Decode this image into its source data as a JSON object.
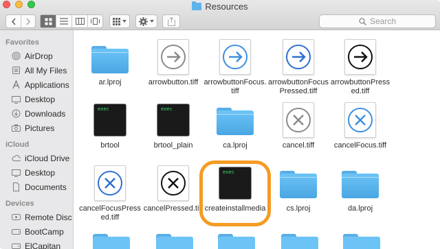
{
  "window": {
    "title": "Resources"
  },
  "toolbar": {
    "back_icon": "chevron-left-icon",
    "forward_icon": "chevron-right-icon",
    "view_modes": [
      "icon-view-icon",
      "list-view-icon",
      "column-view-icon",
      "coverflow-view-icon"
    ],
    "arrange_icon": "arrange-grid-icon",
    "action_icon": "gear-icon",
    "share_icon": "share-icon",
    "search_placeholder": "Search"
  },
  "sidebar": {
    "sections": [
      {
        "title": "Favorites",
        "items": [
          {
            "label": "AirDrop",
            "icon": "airdrop-icon"
          },
          {
            "label": "All My Files",
            "icon": "all-files-icon"
          },
          {
            "label": "Applications",
            "icon": "applications-icon"
          },
          {
            "label": "Desktop",
            "icon": "desktop-icon"
          },
          {
            "label": "Downloads",
            "icon": "downloads-icon"
          },
          {
            "label": "Pictures",
            "icon": "pictures-icon"
          }
        ]
      },
      {
        "title": "iCloud",
        "items": [
          {
            "label": "iCloud Drive",
            "icon": "cloud-icon"
          },
          {
            "label": "Desktop",
            "icon": "desktop-icon"
          },
          {
            "label": "Documents",
            "icon": "documents-icon"
          }
        ]
      },
      {
        "title": "Devices",
        "items": [
          {
            "label": "Remote Disc",
            "icon": "disc-icon"
          },
          {
            "label": "BootCamp",
            "icon": "drive-icon"
          },
          {
            "label": "ElCapitan",
            "icon": "drive-icon"
          }
        ]
      }
    ]
  },
  "files": [
    {
      "name": "ar.lproj",
      "kind": "folder"
    },
    {
      "name": "arrowbutton.tiff",
      "kind": "tiff",
      "glyph": "arrow-gray"
    },
    {
      "name": "arrowbuttonFocus.tiff",
      "kind": "tiff",
      "glyph": "arrow-blue"
    },
    {
      "name": "arrowbuttonFocusPressed.tiff",
      "kind": "tiff",
      "glyph": "arrow-blue-dark"
    },
    {
      "name": "arrowbuttonPressed.tiff",
      "kind": "tiff",
      "glyph": "arrow-black"
    },
    {
      "name": "brtool",
      "kind": "exec"
    },
    {
      "name": "brtool_plain",
      "kind": "exec"
    },
    {
      "name": "ca.lproj",
      "kind": "folder"
    },
    {
      "name": "cancel.tiff",
      "kind": "tiff",
      "glyph": "x-gray"
    },
    {
      "name": "cancelFocus.tiff",
      "kind": "tiff",
      "glyph": "x-blue"
    },
    {
      "name": "cancelFocusPressed.tiff",
      "kind": "tiff",
      "glyph": "x-blue-dark"
    },
    {
      "name": "cancelPressed.tiff",
      "kind": "tiff",
      "glyph": "x-black"
    },
    {
      "name": "createinstallmedia",
      "kind": "exec"
    },
    {
      "name": "cs.lproj",
      "kind": "folder"
    },
    {
      "name": "da.lproj",
      "kind": "folder"
    }
  ],
  "exec_label": "exec",
  "colors": {
    "folder": "#5aaee8",
    "highlight": "#f59b23",
    "blue_glyph": "#3d8fe0",
    "gray_glyph": "#888888"
  }
}
